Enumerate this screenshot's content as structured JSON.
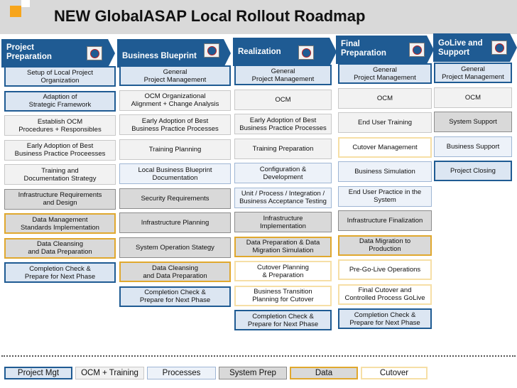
{
  "title": "NEW GlobalASAP Local Rollout Roadmap",
  "phases": [
    {
      "label": "Project\nPreparation",
      "icon": "step-1-icon"
    },
    {
      "label": "Business Blueprint",
      "icon": "step-2-icon"
    },
    {
      "label": "Realization",
      "icon": "step-3-icon"
    },
    {
      "label": "Final\nPreparation",
      "icon": "step-4-icon"
    },
    {
      "label": "GoLive and\nSupport",
      "icon": "step-5-icon"
    }
  ],
  "columns": [
    [
      {
        "text": "Setup of Local Project\nOrganization",
        "type": "pm"
      },
      {
        "text": "Adaption of\nStrategic Framework",
        "type": "pm"
      },
      {
        "text": "Establish OCM\nProcedures + Responsibles",
        "type": "ocm"
      },
      {
        "text": "Early Adoption of Best\nBusiness Practice Proceesses",
        "type": "ocm"
      },
      {
        "text": "Training and\nDocumentation Strategy",
        "type": "ocm"
      },
      {
        "text": "Infrastructure Requirements\nand Design",
        "type": "sys"
      },
      {
        "text": "Data Management\nStandards Implementation",
        "type": "data"
      },
      {
        "text": "Data Cleansing\nand Data Preparation",
        "type": "data"
      },
      {
        "text": "Completion Check &\nPrepare for Next Phase",
        "type": "pm"
      }
    ],
    [
      {
        "text": "General\nProject Management",
        "type": "pm"
      },
      {
        "text": "OCM Organizational\nAlignment + Change Analysis",
        "type": "ocm"
      },
      {
        "text": "Early Adoption of Best\nBusiness Practice Processes",
        "type": "ocm"
      },
      {
        "text": "Training Planning",
        "type": "ocm"
      },
      {
        "text": "Local Business Blueprint\nDocumentation",
        "type": "proc"
      },
      {
        "text": "Security Requirements",
        "type": "sys"
      },
      {
        "text": "Infrastructure Planning",
        "type": "sys"
      },
      {
        "text": "System Operation Stategy",
        "type": "sys"
      },
      {
        "text": "Data Cleansing\nand Data Preparation",
        "type": "data"
      },
      {
        "text": "Completion Check &\nPrepare for Next Phase",
        "type": "pm"
      }
    ],
    [
      {
        "text": "General\nProject Management",
        "type": "pm"
      },
      {
        "text": "OCM",
        "type": "ocm"
      },
      {
        "text": "Early Adoption of Best\nBusiness Practice Processes",
        "type": "ocm"
      },
      {
        "text": "Training Preparation",
        "type": "ocm"
      },
      {
        "text": "Configuration &\nDevelopment",
        "type": "proc"
      },
      {
        "text": "Unit / Process / Integration /\nBusiness Acceptance Testing",
        "type": "proc"
      },
      {
        "text": "Infrastructure\nImplementation",
        "type": "sys"
      },
      {
        "text": "Data Preparation & Data\nMigration Simulation",
        "type": "data"
      },
      {
        "text": "Cutover Planning\n& Preparation",
        "type": "cut"
      },
      {
        "text": "Business Transition\nPlanning for Cutover",
        "type": "cut"
      },
      {
        "text": "Completion Check &\nPrepare for Next Phase",
        "type": "pm"
      }
    ],
    [
      {
        "text": "General\nProject Management",
        "type": "pm"
      },
      {
        "text": "OCM",
        "type": "ocm"
      },
      {
        "text": "End User Training",
        "type": "ocm"
      },
      {
        "text": "Cutover Management",
        "type": "cut"
      },
      {
        "text": "Business Simulation",
        "type": "proc"
      },
      {
        "text": "End User Practice in the\nSystem",
        "type": "proc"
      },
      {
        "text": "Infrastructure Finalization",
        "type": "sys"
      },
      {
        "text": "Data Migration to\nProduction",
        "type": "data"
      },
      {
        "text": "Pre-Go-Live Operations",
        "type": "cut"
      },
      {
        "text": "Final Cutover and\nControlled Process GoLive",
        "type": "cut"
      },
      {
        "text": "Completion Check &\nPrepare for Next Phase",
        "type": "pm"
      }
    ],
    [
      {
        "text": "General\nProject Management",
        "type": "pm"
      },
      {
        "text": "OCM",
        "type": "ocm"
      },
      {
        "text": "System Support",
        "type": "sys"
      },
      {
        "text": "Business Support",
        "type": "proc"
      },
      {
        "text": "Project Closing",
        "type": "pm"
      }
    ]
  ],
  "legend": [
    {
      "label": "Project Mgt",
      "type": "pm"
    },
    {
      "label": "OCM + Training",
      "type": "ocm"
    },
    {
      "label": "Processes",
      "type": "proc"
    },
    {
      "label": "System Prep",
      "type": "sys"
    },
    {
      "label": "Data",
      "type": "data"
    },
    {
      "label": "Cutover",
      "type": "cut"
    }
  ]
}
